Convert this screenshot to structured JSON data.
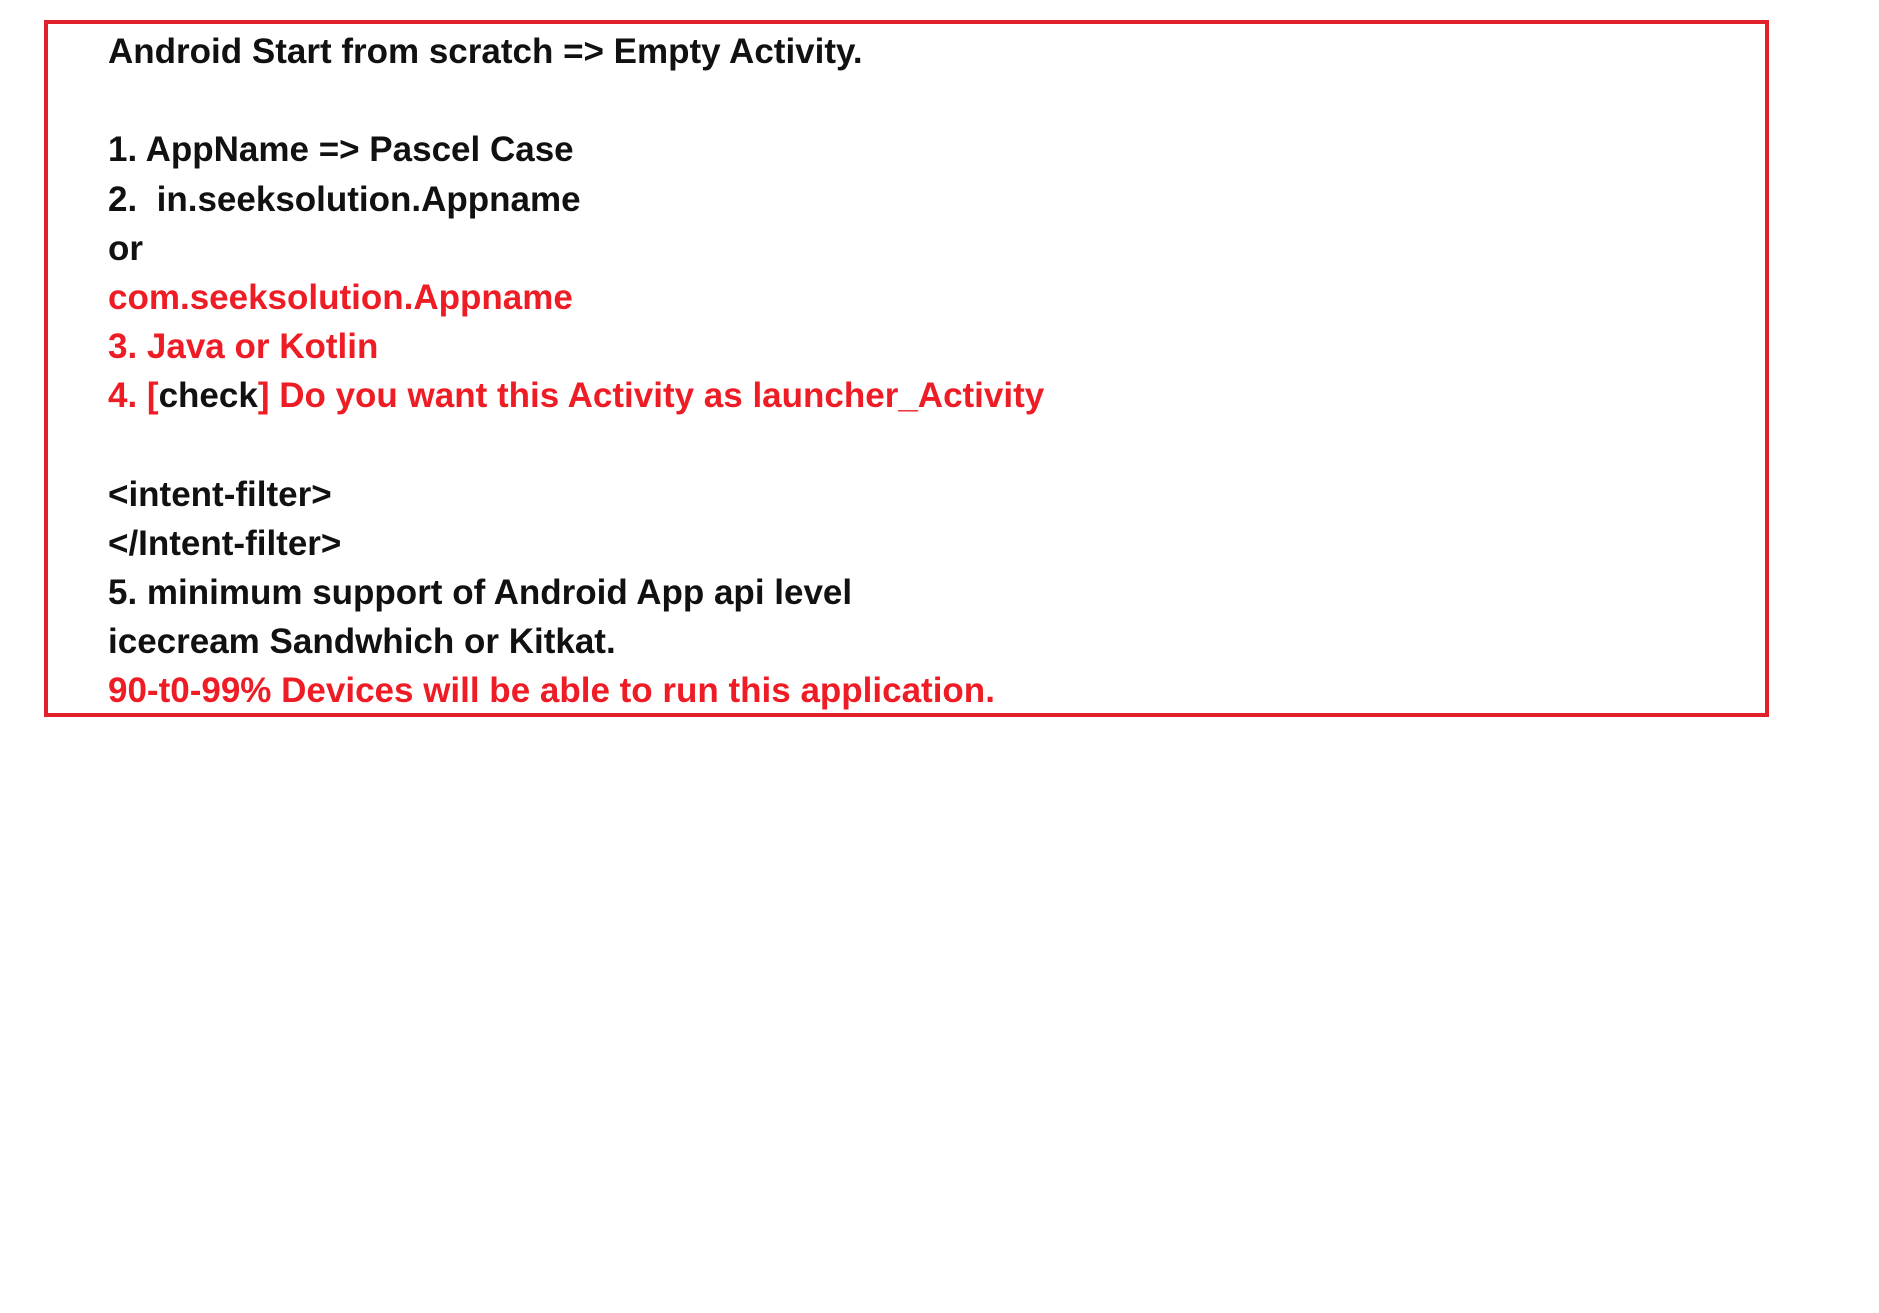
{
  "colors": {
    "border": "#e0202a",
    "text_black": "#111111",
    "text_red": "#ee1c25"
  },
  "note": {
    "lines": [
      {
        "text": "Android Start from scratch => Empty Activity.",
        "color": "black"
      },
      {
        "text": "",
        "color": "black"
      },
      {
        "text": "1. AppName => Pascel Case",
        "color": "black"
      },
      {
        "text": "2.  in.seeksolution.Appname",
        "color": "black"
      },
      {
        "text": "or",
        "color": "black"
      },
      {
        "text": "com.seeksolution.Appname",
        "color": "red"
      },
      {
        "text": "3. Java or Kotlin",
        "color": "red"
      },
      {
        "segments": {
          "a": "4. [",
          "b": "check",
          "c": "] Do you want this Activity as launcher_Activity"
        }
      },
      {
        "text": "",
        "color": "black"
      },
      {
        "text": "<intent-filter>",
        "color": "black"
      },
      {
        "text": "</Intent-filter>",
        "color": "black"
      },
      {
        "text": "5. minimum support of Android App api level",
        "color": "black"
      },
      {
        "text": "icecream Sandwhich or Kitkat.",
        "color": "black"
      },
      {
        "text": "90-t0-99% Devices will be able to run this application.",
        "color": "red"
      }
    ]
  }
}
